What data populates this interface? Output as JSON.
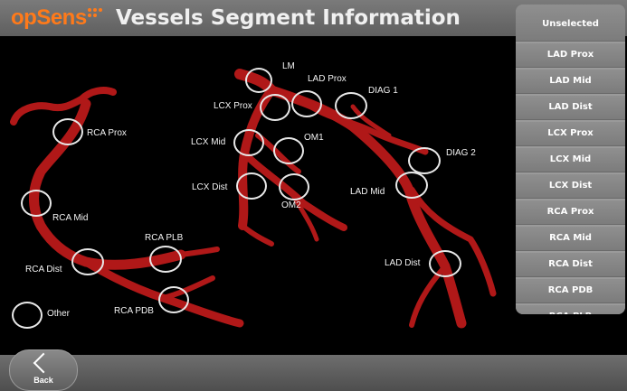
{
  "header": {
    "logo_text": "opSens",
    "title": "Vessels Segment Information"
  },
  "diagram": {
    "vessel_color": "#b01818",
    "labels": {
      "lm": "LM",
      "lad_prox": "LAD Prox",
      "diag1": "DIAG 1",
      "lcx_prox": "LCX Prox",
      "lcx_mid": "LCX Mid",
      "om1": "OM1",
      "diag2": "DIAG 2",
      "lcx_dist": "LCX Dist",
      "om2": "OM2",
      "lad_mid": "LAD Mid",
      "rca_prox": "RCA Prox",
      "rca_mid": "RCA Mid",
      "rca_plb": "RCA PLB",
      "rca_dist": "RCA Dist",
      "lad_dist": "LAD Dist",
      "rca_pdb": "RCA PDB",
      "other": "Other"
    }
  },
  "segment_list": [
    "Unselected",
    "LAD Prox",
    "LAD Mid",
    "LAD Dist",
    "LCX Prox",
    "LCX Mid",
    "LCX Dist",
    "RCA Prox",
    "RCA Mid",
    "RCA Dist",
    "RCA PDB",
    "RCA PLB"
  ],
  "footer": {
    "back_label": "Back"
  }
}
